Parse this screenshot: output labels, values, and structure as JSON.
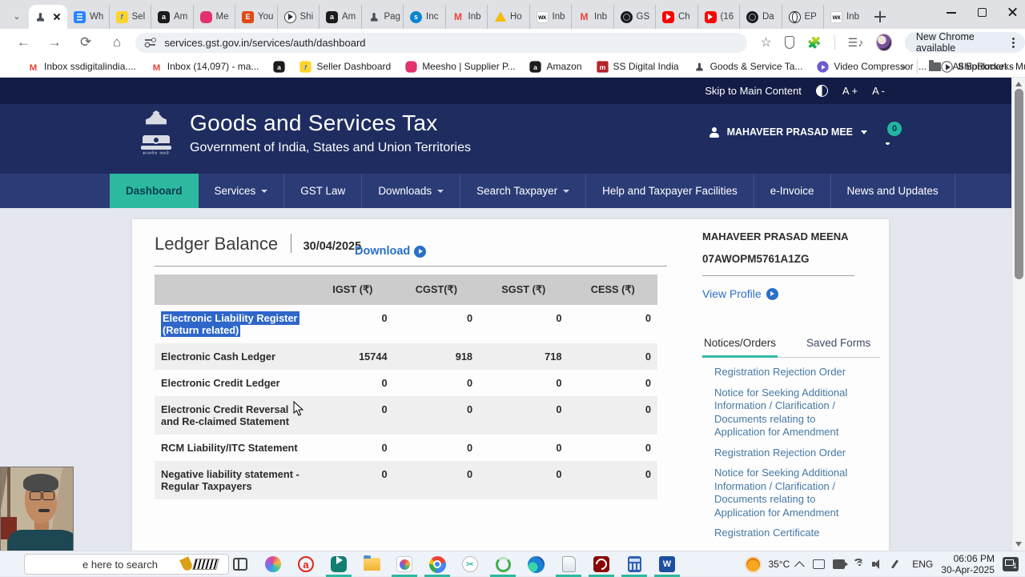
{
  "browser": {
    "tabs": [
      {
        "label": "Wh",
        "icon": "docs"
      },
      {
        "label": "Sel",
        "icon": "flipkart"
      },
      {
        "label": "Am",
        "icon": "amazon"
      },
      {
        "label": "Me",
        "icon": "meesho"
      },
      {
        "label": "You",
        "icon": "youtube-sq"
      },
      {
        "label": "Shi",
        "icon": "shiprocket"
      },
      {
        "label": "Am",
        "icon": "amazon"
      },
      {
        "label": "Pag",
        "icon": "emblem-dark"
      },
      {
        "label": "Inc",
        "icon": "skype"
      },
      {
        "label": "Inb",
        "icon": "gmail"
      },
      {
        "label": "Ho",
        "icon": "drive"
      },
      {
        "label": "Inb",
        "icon": "wix"
      },
      {
        "label": "Inb",
        "icon": "gmail"
      },
      {
        "label": "GS",
        "icon": "dark-ring"
      },
      {
        "label": "Ch",
        "icon": "youtube"
      },
      {
        "label": "(16",
        "icon": "youtube"
      },
      {
        "label": "Da",
        "icon": "dark-ring"
      },
      {
        "label": "EP",
        "icon": "globe"
      },
      {
        "label": "Inb",
        "icon": "wix"
      }
    ],
    "url": "services.gst.gov.in/services/auth/dashboard",
    "update_pill": "New Chrome available",
    "bookmarks": [
      {
        "label": "Inbox ssdigitalindia....",
        "icon": "gmail"
      },
      {
        "label": "Inbox (14,097) - ma...",
        "icon": "gmail"
      },
      {
        "label": "",
        "icon": "amazon"
      },
      {
        "label": "Seller Dashboard",
        "icon": "flipkart"
      },
      {
        "label": "Meesho | Supplier P...",
        "icon": "meesho"
      },
      {
        "label": "Amazon",
        "icon": "amazon"
      },
      {
        "label": "SS Digital India",
        "icon": "m-red"
      },
      {
        "label": "Goods & Service Ta...",
        "icon": "emblem-dark"
      },
      {
        "label": "Video Compressor |...",
        "icon": "video-purple"
      },
      {
        "label": "ShipRocket - Multi-...",
        "icon": "shiprocket"
      }
    ],
    "all_bookmarks": "All Bookmarks"
  },
  "glyphs": {
    "gmail": "M",
    "wix": "wx",
    "amazon": "a",
    "skype": "s",
    "m-red": "m",
    "flipkart": "f",
    "youtube-sq": "E",
    "word": "W",
    "design": "✂"
  },
  "topstrip": {
    "skip": "Skip to Main Content",
    "font_plus": "A +",
    "font_minus": "A -"
  },
  "header": {
    "title": "Goods and Services Tax",
    "subtitle": "Government of India, States and Union Territories",
    "emblem_motto": "सत्यमेव जयते",
    "user": "MAHAVEER PRASAD MEE",
    "bell_badge": "0"
  },
  "nav": {
    "items": [
      {
        "label": "Dashboard",
        "active": true,
        "caret": false
      },
      {
        "label": "Services",
        "active": false,
        "caret": true
      },
      {
        "label": "GST Law",
        "active": false,
        "caret": false
      },
      {
        "label": "Downloads",
        "active": false,
        "caret": true
      },
      {
        "label": "Search Taxpayer",
        "active": false,
        "caret": true
      },
      {
        "label": "Help and Taxpayer Facilities",
        "active": false,
        "caret": false
      },
      {
        "label": "e-Invoice",
        "active": false,
        "caret": false
      },
      {
        "label": "News and Updates",
        "active": false,
        "caret": false
      }
    ]
  },
  "ledger": {
    "title": "Ledger Balance",
    "date": "30/04/2025",
    "download_label": "Download",
    "table": {
      "headers": [
        "IGST (₹)",
        "CGST(₹)",
        "SGST (₹)",
        "CESS (₹)"
      ],
      "rows": [
        {
          "label": "Electronic Liability Register (Return related)",
          "values": [
            "0",
            "0",
            "0",
            "0"
          ],
          "selected": true
        },
        {
          "label": "Electronic Cash Ledger",
          "values": [
            "15744",
            "918",
            "718",
            "0"
          ],
          "selected": false
        },
        {
          "label": "Electronic Credit Ledger",
          "values": [
            "0",
            "0",
            "0",
            "0"
          ],
          "selected": false
        },
        {
          "label": "Electronic Credit Reversal and Re-claimed Statement",
          "values": [
            "0",
            "0",
            "0",
            "0"
          ],
          "selected": false
        },
        {
          "label": "RCM Liability/ITC Statement",
          "values": [
            "0",
            "0",
            "0",
            "0"
          ],
          "selected": false
        },
        {
          "label": "Negative liability statement - Regular Taxpayers",
          "values": [
            "0",
            "0",
            "0",
            "0"
          ],
          "selected": false
        }
      ]
    }
  },
  "profile": {
    "name": "MAHAVEER PRASAD MEENA",
    "gstin": "07AWOPM5761A1ZG",
    "view_profile": "View Profile",
    "tabs": [
      {
        "label": "Notices/Orders",
        "active": true
      },
      {
        "label": "Saved Forms",
        "active": false
      }
    ],
    "notices": [
      "Registration Rejection Order",
      "Notice for Seeking Additional Information / Clarification / Documents relating to Application for Amendment",
      "Registration Rejection Order",
      "Notice for Seeking Additional Information / Clarification / Documents relating to Application for Amendment",
      "Registration Certificate"
    ]
  },
  "taskbar": {
    "search_text": "e here to search",
    "icons": [
      {
        "name": "task-view",
        "cls": "ic-taskview",
        "running": false
      },
      {
        "name": "copilot",
        "cls": "ic-copilot",
        "running": false
      },
      {
        "name": "opera-a",
        "cls": "ic-opera-a",
        "glyph": "a",
        "running": false
      },
      {
        "name": "clipchamp",
        "cls": "ic-clipchamp",
        "running": true
      },
      {
        "name": "file-explorer",
        "cls": "ic-explorer",
        "running": false
      },
      {
        "name": "photos",
        "cls": "ic-photos",
        "running": true
      },
      {
        "name": "chrome",
        "cls": "ic-chrome",
        "running": true
      },
      {
        "name": "design-app",
        "cls": "ic-design",
        "glyphKey": "design",
        "running": false
      },
      {
        "name": "loading-ring",
        "cls": "ic-ring",
        "running": true
      },
      {
        "name": "edge",
        "cls": "ic-edge",
        "running": false
      },
      {
        "name": "notepad",
        "cls": "ic-notepad",
        "running": true
      },
      {
        "name": "acrobat",
        "cls": "ic-acrobat",
        "running": true
      },
      {
        "name": "calculator",
        "cls": "ic-calc",
        "running": true
      },
      {
        "name": "word",
        "cls": "ic-word",
        "glyphKey": "word",
        "running": true
      }
    ],
    "temperature": "35°C",
    "language": "ENG",
    "time": "06:06 PM",
    "date": "30-Apr-2025",
    "notif_badge": "1"
  }
}
